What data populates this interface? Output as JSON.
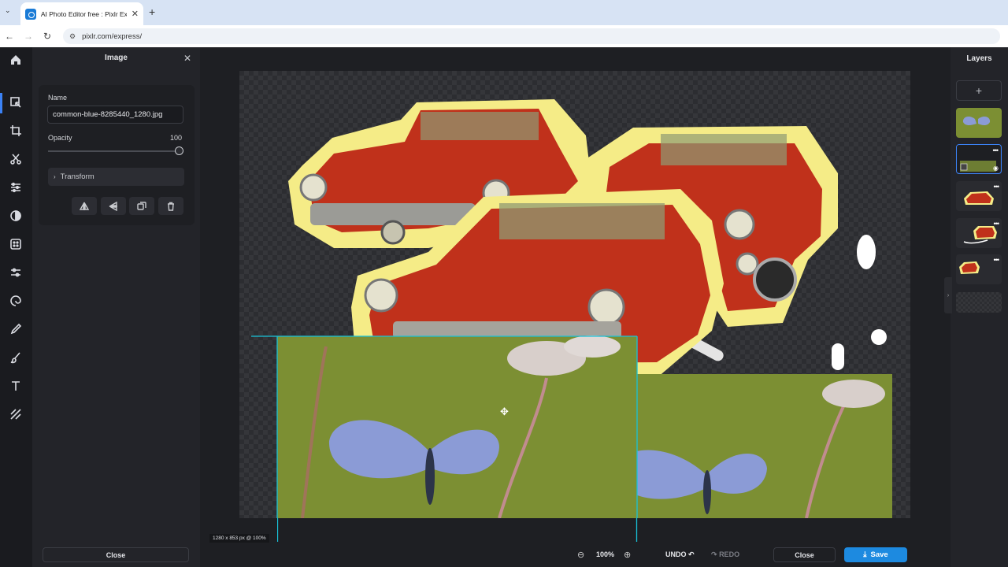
{
  "browser": {
    "tab_title": "AI Photo Editor free : Pixlr Expr...",
    "tab_close": "✕",
    "new_tab": "+",
    "url": "pixlr.com/express/"
  },
  "panel": {
    "title": "Image",
    "name_label": "Name",
    "name_value": "common-blue-8285440_1280.jpg",
    "opacity_label": "Opacity",
    "opacity_value": "100",
    "opacity_level": 1.0,
    "transform_label": "Transform",
    "close_label": "Close"
  },
  "rail_icons": [
    "home-icon",
    "arrange-icon",
    "crop-icon",
    "cutout-icon",
    "adjust-icon",
    "filter-icon",
    "effect-icon",
    "liquify-icon",
    "retouch-icon",
    "draw-icon",
    "brush-icon",
    "text-icon",
    "elements-icon"
  ],
  "canvas": {
    "dimensions_label": "1280 x 853 px @ 100%"
  },
  "layers": {
    "title": "Layers",
    "more_label": "•••"
  },
  "toolbar": {
    "zoom_value": "100%",
    "undo_label": "UNDO",
    "redo_label": "REDO",
    "close_label": "Close",
    "save_label": "Save"
  },
  "colors": {
    "accent": "#1d8ae0",
    "selection": "#18c2d9",
    "car_red": "#c0311b",
    "sticker_outline": "#f5ec87",
    "leaf_green": "#7c8f33"
  }
}
